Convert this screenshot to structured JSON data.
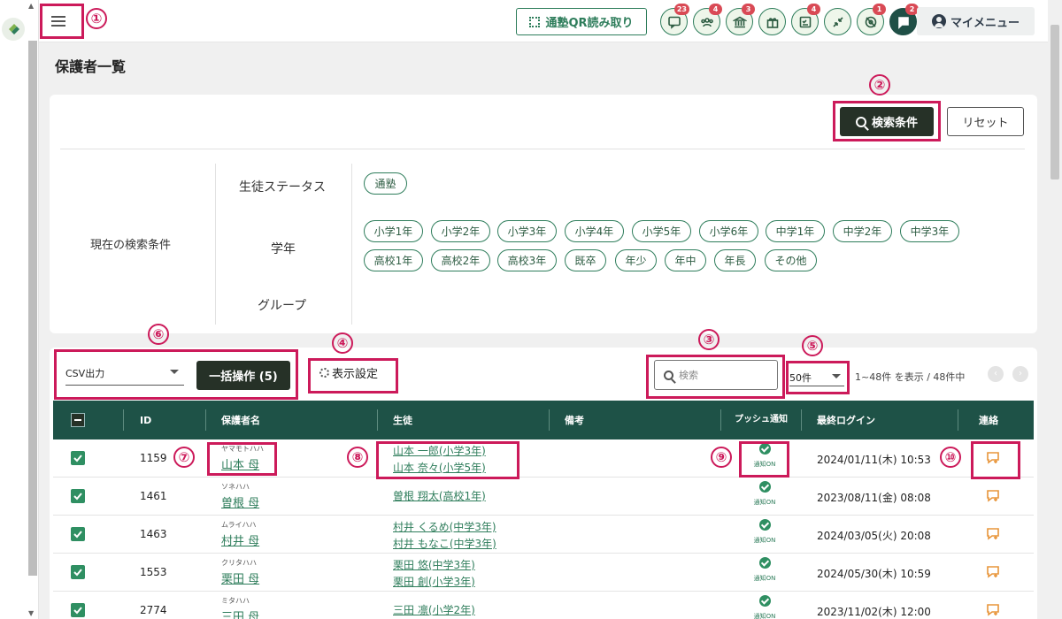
{
  "header": {
    "qr_label": "通塾QR読み取り",
    "my_menu_label": "マイメニュー",
    "icons": [
      {
        "name": "chat-icon",
        "badge": "23"
      },
      {
        "name": "people-icon",
        "badge": "4"
      },
      {
        "name": "school-icon",
        "badge": "3"
      },
      {
        "name": "gift-icon",
        "badge": ""
      },
      {
        "name": "checklist-icon",
        "badge": "4"
      },
      {
        "name": "shrink-icon",
        "badge": ""
      },
      {
        "name": "no-location-icon",
        "badge": "1"
      },
      {
        "name": "message-icon",
        "badge": "2"
      }
    ]
  },
  "page": {
    "title": "保護者一覧"
  },
  "search_panel": {
    "search_button": "検索条件",
    "reset_button": "リセット",
    "current_conditions_label": "現在の検索条件",
    "rows": [
      {
        "label": "生徒ステータス",
        "chips": [
          "通塾"
        ]
      },
      {
        "label": "学年",
        "chips": [
          "小学1年",
          "小学2年",
          "小学3年",
          "小学4年",
          "小学5年",
          "小学6年",
          "中学1年",
          "中学2年",
          "中学3年",
          "高校1年",
          "高校2年",
          "高校3年",
          "既卒",
          "年少",
          "年中",
          "年長",
          "その他"
        ]
      },
      {
        "label": "グループ",
        "chips": []
      }
    ]
  },
  "toolbar": {
    "csv_select": "CSV出力",
    "bulk_button": "一括操作 (5)",
    "display_settings": "表示設定",
    "search_placeholder": "検索",
    "per_page": "50件",
    "range_text": "1~48件 を表示 / 48件中"
  },
  "table": {
    "headers": {
      "id": "ID",
      "guardian": "保護者名",
      "students": "生徒",
      "notes": "備考",
      "push": "プッシュ通知",
      "last_login": "最終ログイン",
      "contact": "連絡"
    },
    "rows": [
      {
        "id": "1159",
        "kana": "ヤマモトハハ",
        "name": "山本 母",
        "students": [
          "山本 一郎(小学3年)",
          "山本 奈々(小学5年)"
        ],
        "push": "通知ON",
        "last_login": "2024/01/11(木) 10:53"
      },
      {
        "id": "1461",
        "kana": "ソネハハ",
        "name": "曽根 母",
        "students": [
          "曽根 翔太(高校1年)"
        ],
        "push": "通知ON",
        "last_login": "2023/08/11(金) 08:08"
      },
      {
        "id": "1463",
        "kana": "ムライハハ",
        "name": "村井 母",
        "students": [
          "村井 くるめ(中学3年)",
          "村井 もなこ(中学3年)"
        ],
        "push": "通知ON",
        "last_login": "2024/03/05(火) 20:08"
      },
      {
        "id": "1553",
        "kana": "クリタハハ",
        "name": "栗田 母",
        "students": [
          "栗田 悠(中学3年)",
          "栗田 創(小学3年)"
        ],
        "push": "通知ON",
        "last_login": "2024/05/30(木) 10:59"
      },
      {
        "id": "2774",
        "kana": "ミタハハ",
        "name": "三田 母",
        "students": [
          "三田 凛(小学2年)"
        ],
        "push": "通知ON",
        "last_login": "2023/11/02(木) 12:00"
      }
    ]
  },
  "annotations": [
    "①",
    "②",
    "③",
    "④",
    "⑤",
    "⑥",
    "⑦",
    "⑧",
    "⑨",
    "⑩"
  ],
  "colors": {
    "brand": "#1e5247",
    "accent": "#2e7d5b",
    "annotation": "#cc1a5a",
    "contact": "#e8953a"
  }
}
